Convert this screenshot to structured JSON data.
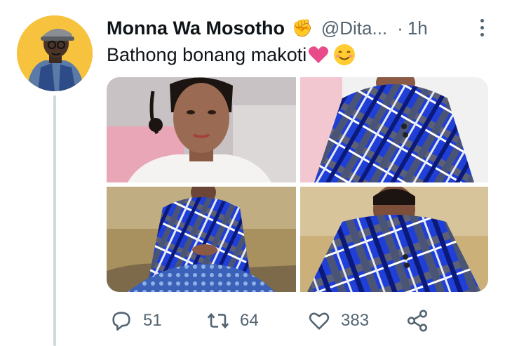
{
  "tweet": {
    "author_name": "Monna Wa Mosotho",
    "author_emoji": "✊",
    "handle": "@Dita...",
    "separator": "·",
    "time": "1h",
    "text": "Bathong bonang makoti"
  },
  "media": {
    "photos": [
      {
        "name": "photo-portrait-white-top"
      },
      {
        "name": "photo-blue-blanket-closeup"
      },
      {
        "name": "photo-seated-blue-blanket"
      },
      {
        "name": "photo-smiling-blue-blanket"
      }
    ]
  },
  "actions": {
    "replies": "51",
    "retweets": "64",
    "likes": "383"
  },
  "icons": {
    "more": "more-vertical-icon",
    "reply": "reply-icon",
    "retweet": "retweet-icon",
    "like": "heart-outline-icon",
    "share": "share-icon"
  },
  "colors": {
    "text": "#0f1419",
    "secondary": "#536471",
    "thread_line": "#cfd9de",
    "avatar_bg": "#f7c33e",
    "blanket_blue": "#1f3fd6"
  }
}
